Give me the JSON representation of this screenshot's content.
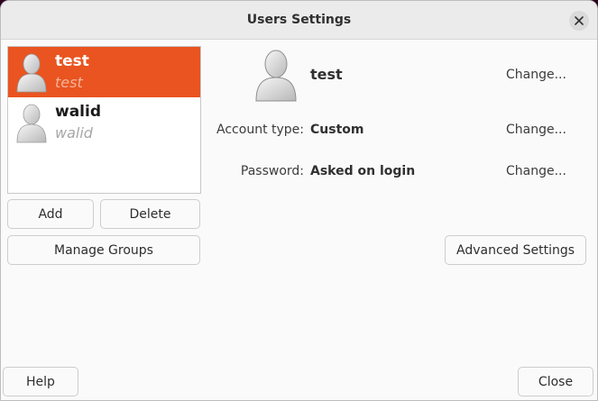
{
  "window": {
    "title": "Users Settings",
    "close_icon": "close-icon"
  },
  "users": [
    {
      "username": "test",
      "fullname": "test",
      "selected": true
    },
    {
      "username": "walid",
      "fullname": "walid",
      "selected": false
    }
  ],
  "list_buttons": {
    "add": "Add",
    "delete": "Delete",
    "manage_groups": "Manage Groups"
  },
  "details": {
    "username": "test",
    "account_type_label": "Account type:",
    "account_type_value": "Custom",
    "password_label": "Password:",
    "password_value": "Asked on login",
    "change_label": "Change...",
    "advanced_settings": "Advanced Settings"
  },
  "footer": {
    "help": "Help",
    "close": "Close"
  },
  "colors": {
    "accent": "#e95420",
    "background": "#fafafa",
    "titlebar": "#ebebeb",
    "desktop": "#2c001e"
  }
}
